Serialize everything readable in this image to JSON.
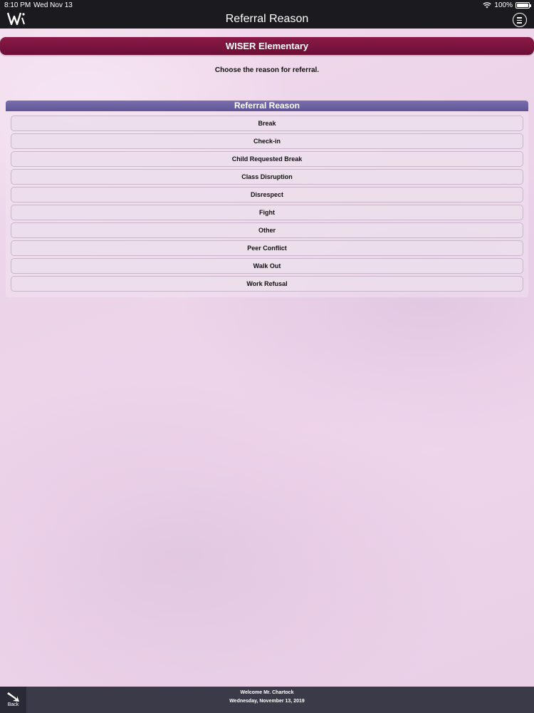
{
  "status_bar": {
    "time": "8:10 PM",
    "date": "Wed Nov 13",
    "battery": "100%"
  },
  "nav": {
    "title": "Referral Reason"
  },
  "school": {
    "name": "WISER Elementary"
  },
  "instructions": "Choose the reason for referral.",
  "panel": {
    "header": "Referral Reason",
    "reasons": [
      "Break",
      "Check-in",
      "Child Requested Break",
      "Class Disruption",
      "Disrespect",
      "Fight",
      "Other",
      "Peer Conflict",
      "Walk Out",
      "Work Refusal"
    ]
  },
  "footer": {
    "back_label": "Back",
    "welcome": "Welcome Mr. Chartock",
    "date": "Wednesday, November 13, 2019"
  },
  "colors": {
    "banner": "#7a1240",
    "panel_header": "#6a60a0",
    "topbar": "#1b1b1f",
    "bottombar": "#3b3a48"
  }
}
